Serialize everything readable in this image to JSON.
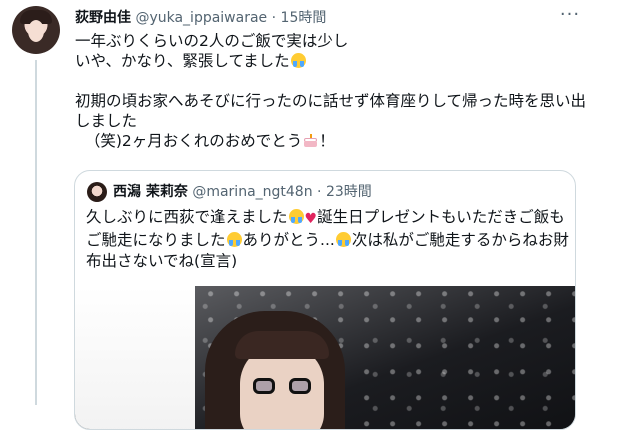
{
  "tweet": {
    "author_name": "荻野由佳",
    "author_handle": "@yuka_ippaiwarae",
    "separator": "·",
    "time": "15時間",
    "more_label": "···",
    "lines": [
      "一年ぶりくらいの2人のご飯で実は少し",
      "いや、かなり、緊張してました",
      "初期の頃お家へあそびに行ったのに話せず体育座りして帰った時を思い出",
      "しました",
      "（笑)2ヶ月おくれのおめでとう",
      "！"
    ]
  },
  "quoted": {
    "author_name": "西潟 茉莉奈",
    "author_handle": "@marina_ngt48n",
    "separator": "·",
    "time": "23時間",
    "lines": [
      "久しぶりに西荻で逢えました",
      "誕生日プレゼントもいただきご飯も",
      "ご馳走になりました",
      "ありがとう...",
      "次は私がご馳走するからねお財",
      "布出さないでね(宣言)"
    ]
  },
  "icons": {
    "crying_laughing": "crying-face-emoji",
    "heart": "heart-emoji",
    "cake": "birthday-cake-emoji"
  },
  "colors": {
    "text": "#0f1419",
    "secondary": "#536471",
    "border": "#cfd9de",
    "background": "#ffffff"
  }
}
